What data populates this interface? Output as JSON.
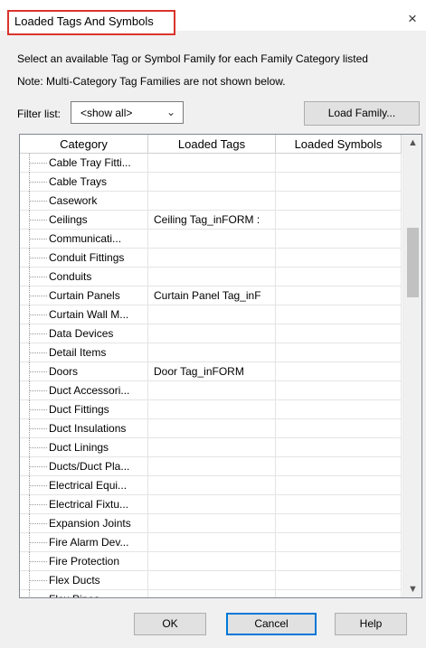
{
  "window": {
    "title": "Loaded Tags And Symbols",
    "close_glyph": "×"
  },
  "description": {
    "line1": "Select an available Tag or Symbol Family for each Family Category listed",
    "line2": "Note: Multi-Category Tag Families are not shown below."
  },
  "filter": {
    "label": "Filter list:",
    "value": "<show all>"
  },
  "load_family_label": "Load Family...",
  "table": {
    "columns": [
      "Category",
      "Loaded Tags",
      "Loaded Symbols"
    ],
    "rows": [
      {
        "category": "Cable Tray Fitti...",
        "tag": "",
        "symbol": ""
      },
      {
        "category": "Cable Trays",
        "tag": "",
        "symbol": ""
      },
      {
        "category": "Casework",
        "tag": "",
        "symbol": ""
      },
      {
        "category": "Ceilings",
        "tag": "Ceiling Tag_inFORM :",
        "symbol": ""
      },
      {
        "category": "Communicati...",
        "tag": "",
        "symbol": ""
      },
      {
        "category": "Conduit Fittings",
        "tag": "",
        "symbol": ""
      },
      {
        "category": "Conduits",
        "tag": "",
        "symbol": ""
      },
      {
        "category": "Curtain Panels",
        "tag": "Curtain Panel Tag_inF",
        "symbol": ""
      },
      {
        "category": "Curtain Wall M...",
        "tag": "",
        "symbol": ""
      },
      {
        "category": "Data Devices",
        "tag": "",
        "symbol": ""
      },
      {
        "category": "Detail Items",
        "tag": "",
        "symbol": ""
      },
      {
        "category": "Doors",
        "tag": "Door Tag_inFORM",
        "symbol": ""
      },
      {
        "category": "Duct Accessori...",
        "tag": "",
        "symbol": ""
      },
      {
        "category": "Duct Fittings",
        "tag": "",
        "symbol": ""
      },
      {
        "category": "Duct Insulations",
        "tag": "",
        "symbol": ""
      },
      {
        "category": "Duct Linings",
        "tag": "",
        "symbol": ""
      },
      {
        "category": "Ducts/Duct Pla...",
        "tag": "",
        "symbol": ""
      },
      {
        "category": "Electrical Equi...",
        "tag": "",
        "symbol": ""
      },
      {
        "category": "Electrical Fixtu...",
        "tag": "",
        "symbol": ""
      },
      {
        "category": "Expansion Joints",
        "tag": "",
        "symbol": ""
      },
      {
        "category": "Fire Alarm Dev...",
        "tag": "",
        "symbol": ""
      },
      {
        "category": "Fire Protection",
        "tag": "",
        "symbol": ""
      },
      {
        "category": "Flex Ducts",
        "tag": "",
        "symbol": ""
      },
      {
        "category": "Flex Pipes",
        "tag": "",
        "symbol": ""
      }
    ]
  },
  "buttons": {
    "ok": "OK",
    "cancel": "Cancel",
    "help": "Help"
  },
  "colors": {
    "title_highlight": "#d9342b",
    "focus_border": "#0078d7"
  }
}
